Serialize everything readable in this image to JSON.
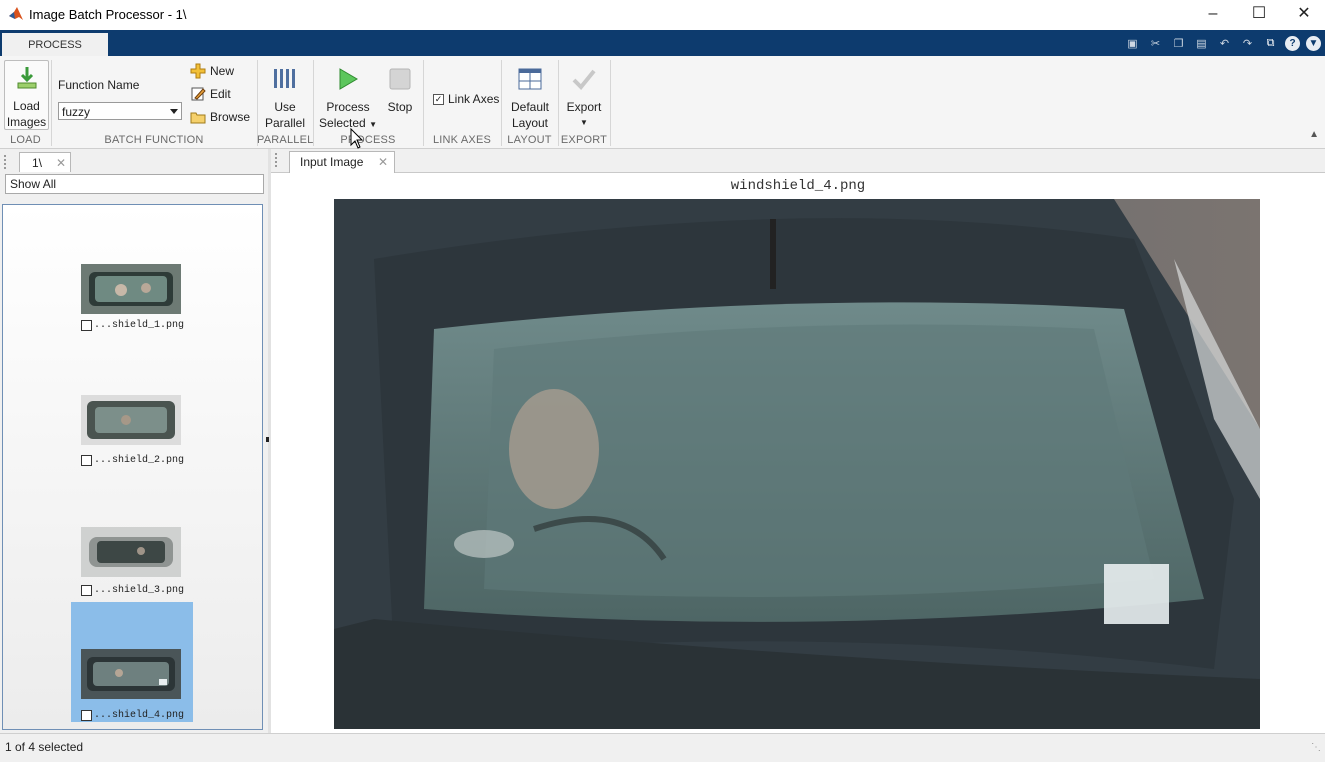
{
  "window": {
    "title": "Image Batch Processor - 1\\",
    "controls": [
      "minimize-icon",
      "maximize-icon",
      "close-icon"
    ]
  },
  "ribbon_tab": {
    "label": "PROCESS"
  },
  "quick_access": [
    "save-icon",
    "cut-icon",
    "copy-icon",
    "paste-icon",
    "undo-icon",
    "redo-icon",
    "window-icon",
    "help-icon",
    "options-icon"
  ],
  "ribbon": {
    "load": {
      "button_line1": "Load",
      "button_line2": "Images",
      "section": "LOAD"
    },
    "batch_function": {
      "label": "Function Name",
      "value": "fuzzy",
      "new_label": "New",
      "edit_label": "Edit",
      "browse_label": "Browse",
      "section": "BATCH FUNCTION"
    },
    "parallel": {
      "line1": "Use",
      "line2": "Parallel",
      "section": "PARALLEL"
    },
    "process": {
      "process_line1": "Process",
      "process_line2": "Selected",
      "stop_label": "Stop",
      "section": "PROCESS"
    },
    "link_axes": {
      "label": "Link Axes",
      "checked": true,
      "section": "LINK AXES"
    },
    "layout": {
      "line1": "Default",
      "line2": "Layout",
      "section": "LAYOUT"
    },
    "export": {
      "label": "Export",
      "section": "EXPORT"
    }
  },
  "left_panel": {
    "tab_label": "1\\",
    "filter_value": "Show All",
    "thumbnails": [
      {
        "caption": "...shield_1.png",
        "selected": false
      },
      {
        "caption": "...shield_2.png",
        "selected": false
      },
      {
        "caption": "...shield_3.png",
        "selected": false
      },
      {
        "caption": "...shield_4.png",
        "selected": true
      }
    ]
  },
  "right_panel": {
    "tab_label": "Input Image",
    "image_title": "windshield_4.png"
  },
  "status": {
    "text": "1 of 4 selected"
  },
  "colors": {
    "tab_strip": "#0d3b6e",
    "selection": "#8bbde9",
    "play_green": "#3daa3d"
  }
}
